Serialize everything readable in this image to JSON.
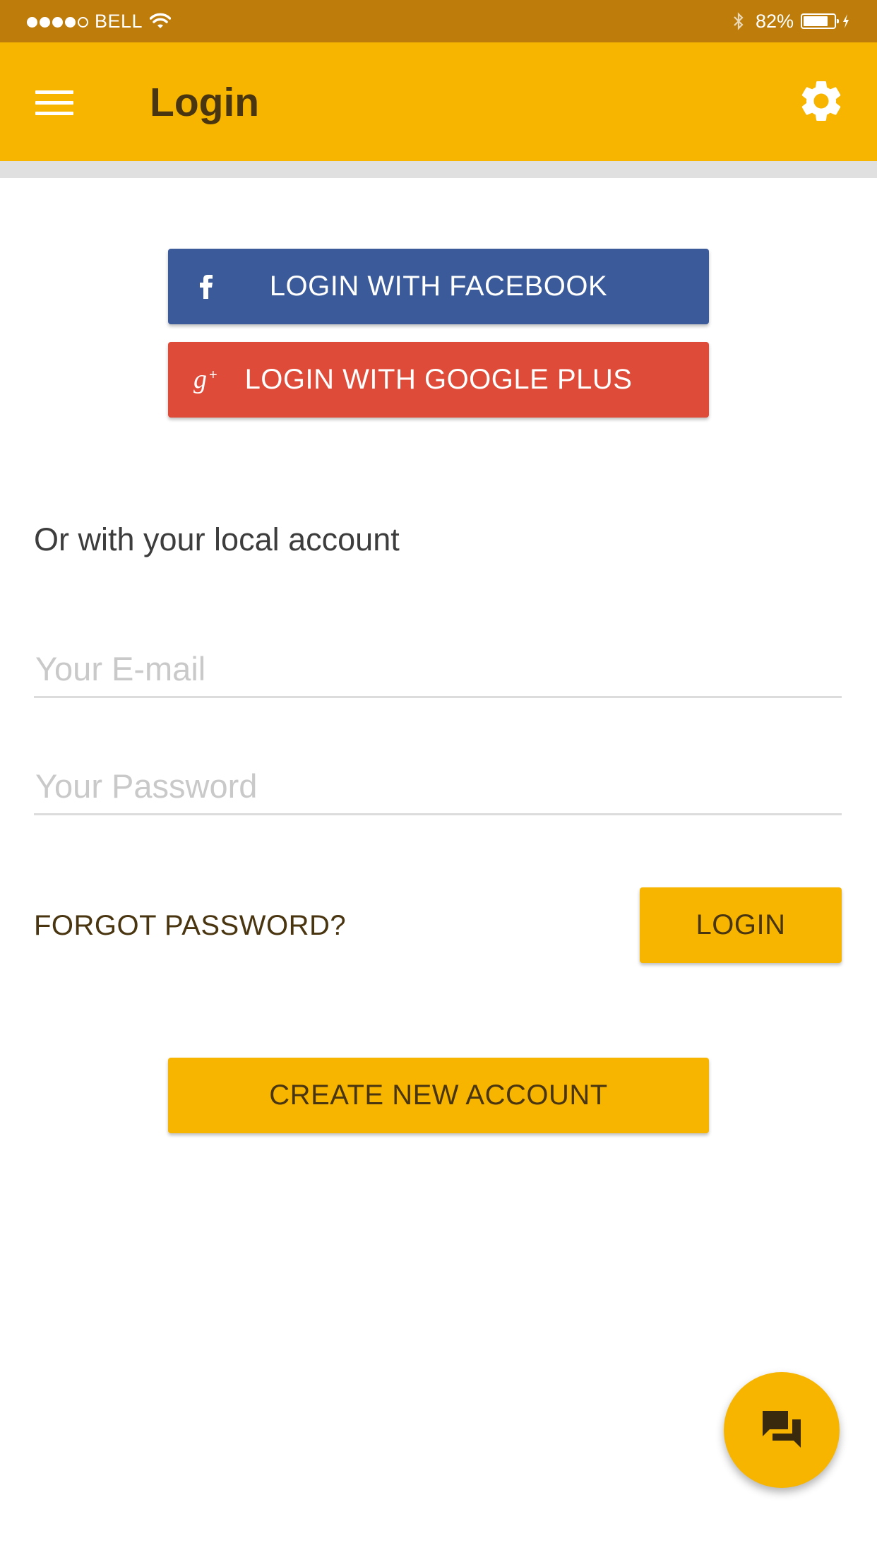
{
  "status_bar": {
    "carrier": "BELL",
    "battery_percent": "82%",
    "battery_level": 0.82,
    "signal_bars_filled": 4,
    "signal_bars_total": 5,
    "icons": [
      "wifi-icon",
      "bluetooth-icon",
      "battery-icon",
      "charging-icon"
    ]
  },
  "app_bar": {
    "title": "Login",
    "left_icon": "menu-icon",
    "right_icon": "gear-icon",
    "background_color": "#f7b500"
  },
  "social": {
    "facebook_label": "LOGIN WITH FACEBOOK",
    "facebook_icon": "facebook-icon",
    "facebook_color": "#3b5a9a",
    "google_label": "LOGIN WITH GOOGLE PLUS",
    "google_icon": "google-plus-icon",
    "google_color": "#de4b39"
  },
  "local": {
    "heading": "Or with your local account",
    "email_placeholder": "Your E-mail",
    "email_value": "",
    "password_placeholder": "Your Password",
    "password_value": "",
    "forgot_label": "FORGOT PASSWORD?",
    "login_label": "LOGIN",
    "create_label": "CREATE NEW ACCOUNT"
  },
  "fab": {
    "icon": "chat-icon"
  },
  "colors": {
    "accent": "#f7b500",
    "status_bar": "#be7c0b",
    "text_dark": "#4a3511"
  }
}
